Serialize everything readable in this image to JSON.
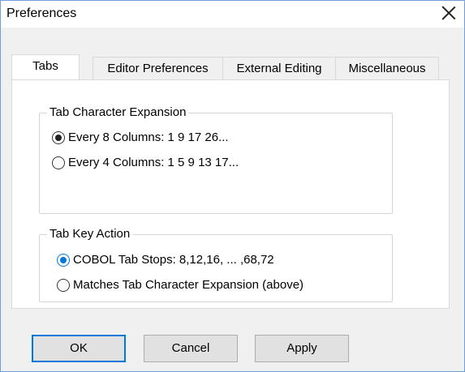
{
  "window": {
    "title": "Preferences"
  },
  "tabs": [
    {
      "label": "Tabs"
    },
    {
      "label": "Editor Preferences"
    },
    {
      "label": "External Editing"
    },
    {
      "label": "Miscellaneous"
    }
  ],
  "groups": {
    "tab_char_expansion": {
      "legend": "Tab Character Expansion",
      "options": [
        {
          "label": "Every 8 Columns: 1 9 17 26...",
          "selected": true
        },
        {
          "label": "Every 4 Columns: 1 5 9 13 17...",
          "selected": false
        }
      ]
    },
    "tab_key_action": {
      "legend": "Tab Key Action",
      "options": [
        {
          "label": "COBOL Tab Stops: 8,12,16, ... ,68,72",
          "selected": true
        },
        {
          "label": "Matches Tab Character Expansion (above)",
          "selected": false
        }
      ]
    }
  },
  "buttons": {
    "ok": "OK",
    "cancel": "Cancel",
    "apply": "Apply"
  },
  "colors": {
    "accent": "#0078d7",
    "window_border": "#6f9fd8"
  }
}
